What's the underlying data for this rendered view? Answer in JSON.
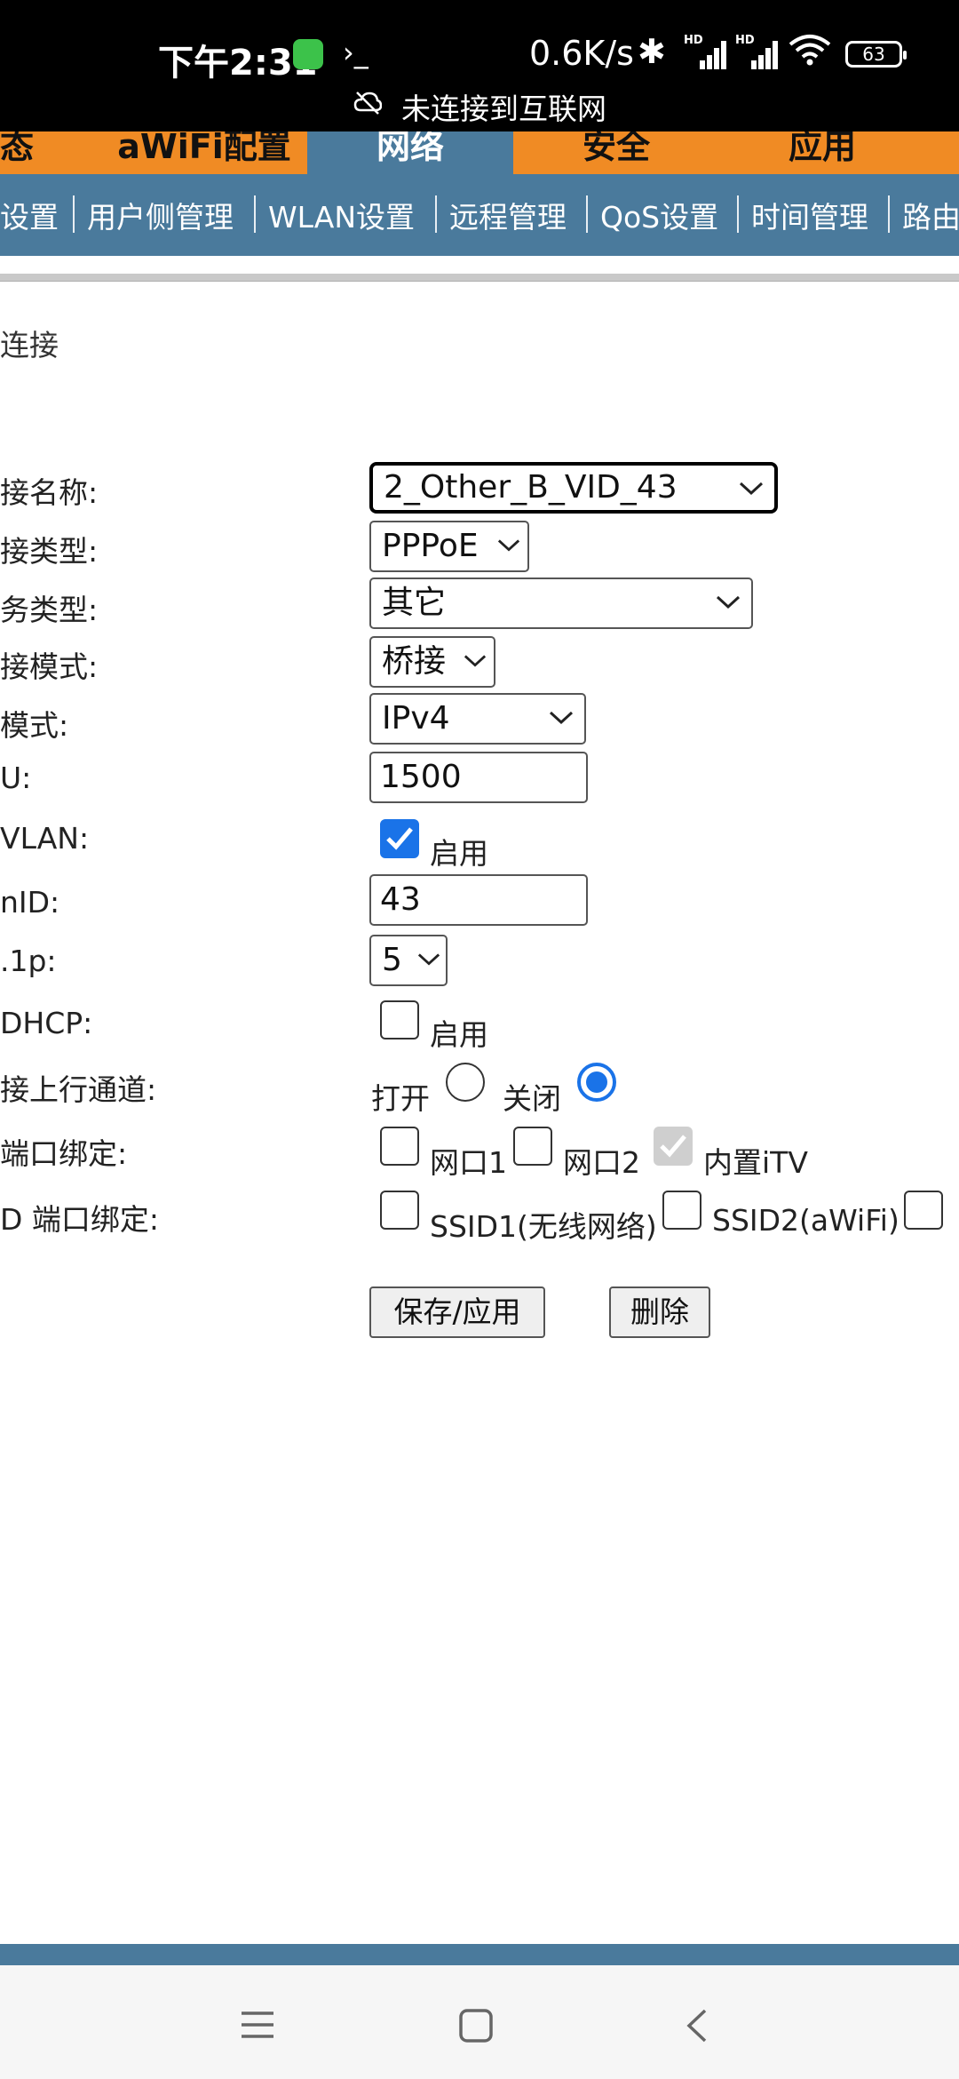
{
  "status_bar": {
    "time": "下午2:31",
    "terminal_icon": "›_",
    "speed": "0.6K/s",
    "signal_label_1": "HD",
    "signal_label_2": "HD",
    "battery": "63",
    "network_status": "未连接到互联网",
    "icons": [
      "app-notification-icon",
      "terminal-icon",
      "bluetooth-icon",
      "signal-icon",
      "wifi-icon",
      "battery-icon",
      "cloud-off-icon"
    ]
  },
  "top_tabs": [
    "态",
    "aWiFi配置",
    "网络",
    "安全",
    "应用"
  ],
  "active_top_tab": "网络",
  "sub_nav": [
    "设置",
    "用户侧管理",
    "WLAN设置",
    "远程管理",
    "QoS设置",
    "时间管理",
    "路由"
  ],
  "section_title": "连接",
  "form": {
    "labels": {
      "conn_name": "接名称:",
      "conn_type": "接类型:",
      "service_type": "务类型:",
      "conn_mode": "接模式:",
      "ip_mode": "模式:",
      "mtu": "U:",
      "vlan": "VLAN:",
      "vlan_id": "nID:",
      "priority": ".1p:",
      "dhcp": "DHCP:",
      "upstream": "接上行通道:",
      "lan_bind": "端口绑定:",
      "ssid_bind": "D 端口绑定:"
    },
    "conn_name_value": "2_Other_B_VID_43",
    "conn_type_value": "PPPoE",
    "service_type_value": "其它",
    "conn_mode_value": "桥接",
    "ip_mode_value": "IPv4",
    "mtu_value": "1500",
    "vlan_enable_label": "启用",
    "vlan_enabled": true,
    "vlan_id_value": "43",
    "priority_value": "5",
    "dhcp_enable_label": "启用",
    "dhcp_enabled": false,
    "upstream_open_label": "打开",
    "upstream_close_label": "关闭",
    "upstream_selected": "关闭",
    "lan_ports": [
      "网口1",
      "网口2",
      "内置iTV"
    ],
    "ssid_ports": [
      "SSID1(无线网络)",
      "SSID2(aWiFi)"
    ],
    "save_button": "保存/应用",
    "delete_button": "删除"
  },
  "colors": {
    "tab_orange": "#f08b24",
    "nav_blue": "#4a7a9c",
    "check_blue": "#1a73e8"
  }
}
